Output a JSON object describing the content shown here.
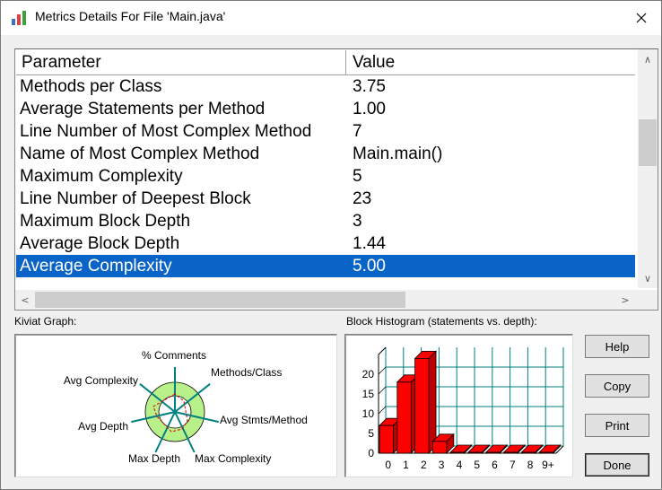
{
  "window": {
    "title": "Metrics Details For File 'Main.java'"
  },
  "table": {
    "headers": {
      "parameter": "Parameter",
      "value": "Value"
    },
    "rows": [
      {
        "parameter": "Methods per Class",
        "value": "3.75"
      },
      {
        "parameter": "Average Statements per Method",
        "value": "1.00"
      },
      {
        "parameter": "Line Number of Most Complex Method",
        "value": "7"
      },
      {
        "parameter": "Name of Most Complex Method",
        "value": "Main.main()"
      },
      {
        "parameter": "Maximum Complexity",
        "value": "5"
      },
      {
        "parameter": "Line Number of Deepest Block",
        "value": "23"
      },
      {
        "parameter": "Maximum Block Depth",
        "value": "3"
      },
      {
        "parameter": "Average Block Depth",
        "value": "1.44"
      },
      {
        "parameter": "Average Complexity",
        "value": "5.00",
        "selected": true
      }
    ]
  },
  "kiviat": {
    "label": "Kiviat Graph:",
    "axes": [
      "% Comments",
      "Methods/Class",
      "Avg Stmts/Method",
      "Max Complexity",
      "Max Depth",
      "Avg Depth",
      "Avg Complexity"
    ],
    "ring_color": "#b8f08a"
  },
  "histogram": {
    "label": "Block Histogram (statements vs. depth):",
    "categories": [
      "0",
      "1",
      "2",
      "3",
      "4",
      "5",
      "6",
      "7",
      "8",
      "9+"
    ],
    "values": [
      7,
      18,
      24,
      3,
      0,
      0,
      0,
      0,
      0,
      0
    ],
    "y_ticks": [
      "0",
      "5",
      "10",
      "15",
      "20"
    ],
    "ylim": [
      0,
      25
    ],
    "bar_color": "#ff0000",
    "grid_color": "#008080"
  },
  "buttons": {
    "help": "Help",
    "copy": "Copy",
    "print": "Print",
    "done": "Done"
  }
}
